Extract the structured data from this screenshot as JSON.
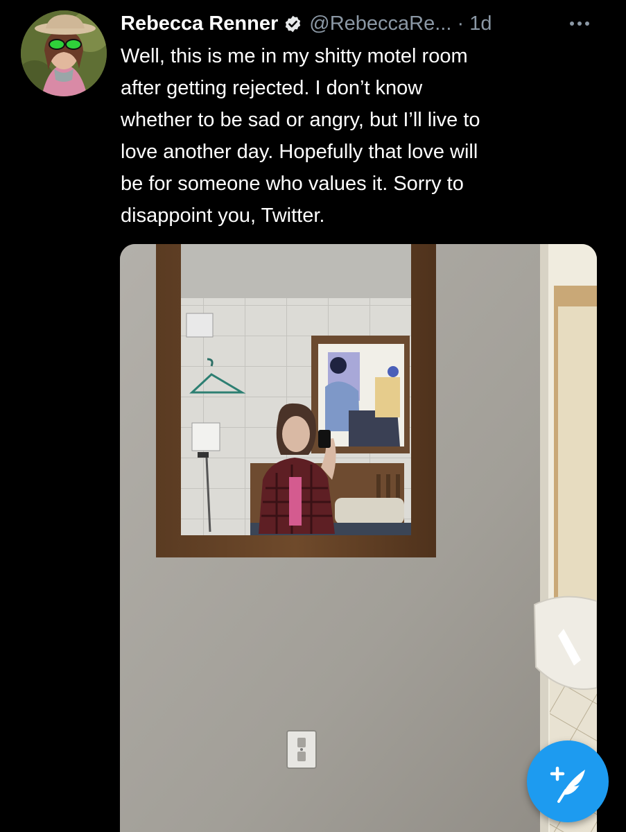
{
  "tweet": {
    "author_name": "Rebecca Renner",
    "handle_time": "@RebeccaRe... · 1d",
    "text": "Well, this is me in my shitty motel room\nafter getting rejected. I don’t know\nwhether to be sad or angry, but I’ll live to\nlove another day. Hopefully that love will\nbe for someone who values it. Sorry to\ndisappoint you, Twitter."
  },
  "icons": {
    "verified": "verified-badge-icon",
    "more": "more-options-icon",
    "compose": "compose-tweet-icon"
  },
  "colors": {
    "background": "#000000",
    "secondary_text": "#8b98a5",
    "accent": "#1d9bf0"
  }
}
